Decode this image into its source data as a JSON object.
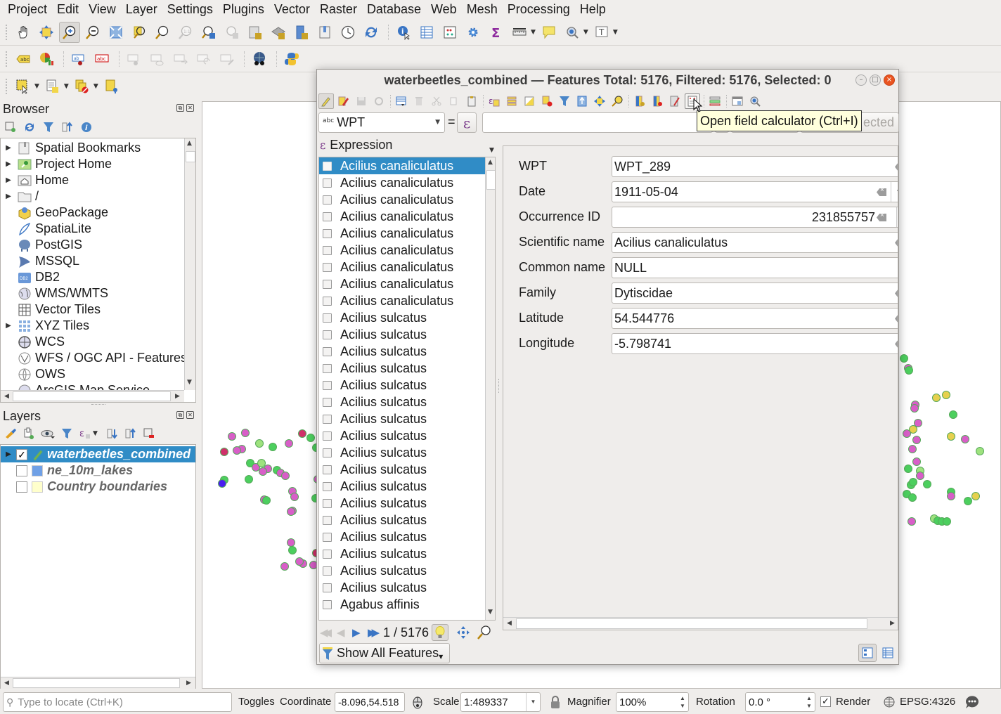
{
  "menu": [
    "Project",
    "Edit",
    "View",
    "Layer",
    "Settings",
    "Plugins",
    "Vector",
    "Raster",
    "Database",
    "Web",
    "Mesh",
    "Processing",
    "Help"
  ],
  "browser": {
    "title": "Browser",
    "items": [
      {
        "label": "Spatial Bookmarks",
        "icon": "bookmark-icon",
        "expandable": true
      },
      {
        "label": "Project Home",
        "icon": "project-home-icon",
        "expandable": true
      },
      {
        "label": "Home",
        "icon": "home-folder-icon",
        "expandable": true
      },
      {
        "label": "/",
        "icon": "folder-icon",
        "expandable": true
      },
      {
        "label": "GeoPackage",
        "icon": "geopackage-icon",
        "expandable": false
      },
      {
        "label": "SpatiaLite",
        "icon": "spatialite-icon",
        "expandable": false
      },
      {
        "label": "PostGIS",
        "icon": "postgis-icon",
        "expandable": false
      },
      {
        "label": "MSSQL",
        "icon": "mssql-icon",
        "expandable": false
      },
      {
        "label": "DB2",
        "icon": "db2-icon",
        "expandable": false
      },
      {
        "label": "WMS/WMTS",
        "icon": "wms-globe-icon",
        "expandable": false
      },
      {
        "label": "Vector Tiles",
        "icon": "vector-tiles-icon",
        "expandable": false
      },
      {
        "label": "XYZ Tiles",
        "icon": "xyz-tiles-icon",
        "expandable": true
      },
      {
        "label": "WCS",
        "icon": "wcs-globe-icon",
        "expandable": false
      },
      {
        "label": "WFS / OGC API - Features",
        "icon": "wfs-globe-icon",
        "expandable": false
      },
      {
        "label": "OWS",
        "icon": "ows-globe-icon",
        "expandable": false
      },
      {
        "label": "ArcGIS Map Service",
        "icon": "arcgis-icon",
        "expandable": false
      }
    ]
  },
  "layers": {
    "title": "Layers",
    "items": [
      {
        "label": "waterbeetles_combined",
        "checked": true,
        "selected": true,
        "swatch": "#7cb342"
      },
      {
        "label": "ne_10m_lakes",
        "checked": false,
        "selected": false,
        "swatch": "#6fa0e6"
      },
      {
        "label": "Country boundaries",
        "checked": false,
        "selected": false,
        "swatch": "#ffffcc"
      }
    ]
  },
  "dialog": {
    "title": "waterbeetles_combined — Features Total: 5176, Filtered: 5176, Selected: 0",
    "field_select": {
      "type_badge": "abc",
      "value": "WPT"
    },
    "equals": "=",
    "expression_label": "Expression",
    "filter_placeholder_tail": "ected",
    "tooltip": "Open field calculator (Ctrl+I)",
    "list": [
      "Acilius canaliculatus",
      "Acilius canaliculatus",
      "Acilius canaliculatus",
      "Acilius canaliculatus",
      "Acilius canaliculatus",
      "Acilius canaliculatus",
      "Acilius canaliculatus",
      "Acilius canaliculatus",
      "Acilius canaliculatus",
      "Acilius sulcatus",
      "Acilius sulcatus",
      "Acilius sulcatus",
      "Acilius sulcatus",
      "Acilius sulcatus",
      "Acilius sulcatus",
      "Acilius sulcatus",
      "Acilius sulcatus",
      "Acilius sulcatus",
      "Acilius sulcatus",
      "Acilius sulcatus",
      "Acilius sulcatus",
      "Acilius sulcatus",
      "Acilius sulcatus",
      "Acilius sulcatus",
      "Acilius sulcatus",
      "Acilius sulcatus",
      "Agabus affinis"
    ],
    "selected_index": 0,
    "nav": {
      "position": "1 / 5176"
    },
    "show_all": "Show All Features",
    "form": [
      {
        "label": "WPT",
        "value": "WPT_289",
        "align": "left",
        "clear": true
      },
      {
        "label": "Date",
        "value": "1911-05-04",
        "align": "left",
        "clear": true,
        "dropdown": true
      },
      {
        "label": "Occurrence ID",
        "value": "231855757",
        "align": "right",
        "clear": true,
        "spin": true
      },
      {
        "label": "Scientific name",
        "value": "Acilius canaliculatus",
        "align": "left",
        "clear": true
      },
      {
        "label": "Common name",
        "value": "NULL",
        "align": "left",
        "clear": false
      },
      {
        "label": "Family",
        "value": "Dytiscidae",
        "align": "left",
        "clear": true
      },
      {
        "label": "Latitude",
        "value": "54.544776",
        "align": "left",
        "clear": true
      },
      {
        "label": "Longitude",
        "value": "-5.798741",
        "align": "left",
        "clear": true
      }
    ]
  },
  "status": {
    "locator_placeholder": "Type to locate (Ctrl+K)",
    "toggles": "Toggles",
    "coordinate_label": "Coordinate",
    "coordinate": "-8.096,54.518",
    "scale_label": "Scale",
    "scale": "1:489337",
    "magnifier_label": "Magnifier",
    "magnifier": "100%",
    "rotation_label": "Rotation",
    "rotation": "0.0 °",
    "render_label": "Render",
    "render_checked": true,
    "crs": "EPSG:4326"
  },
  "colors": {
    "selection": "#308cc6",
    "point_green": "#4ccf5e",
    "point_pink": "#d85ec8",
    "point_red": "#d0306a",
    "point_yellow": "#e6d04e",
    "point_lightgreen": "#9ee27e",
    "point_blue": "#4a1ef0"
  }
}
